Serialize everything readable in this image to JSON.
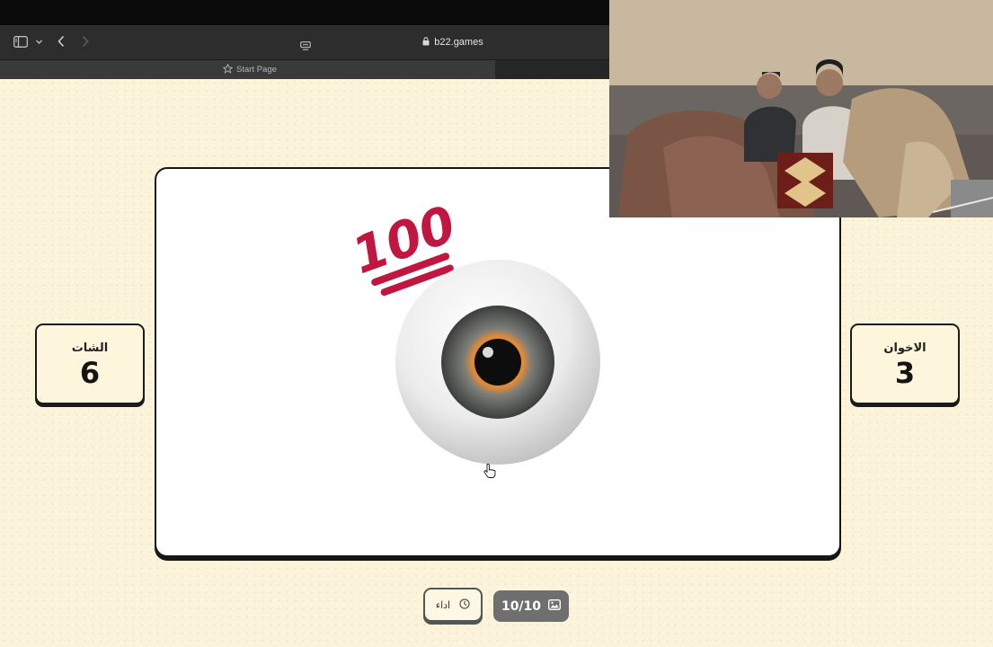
{
  "browser": {
    "address": "b22.games",
    "favorites_item": "Start Page"
  },
  "game": {
    "left_team": {
      "name": "الشات",
      "score": "6"
    },
    "right_team": {
      "name": "الاخوان",
      "score": "3"
    },
    "question_emojis": [
      "100-emoji",
      "eye-emoji"
    ],
    "performance_button": "اداء",
    "counter": "10/10"
  },
  "colors": {
    "page_bg": "#fcf4da",
    "hundred_red": "#c0163f",
    "counter_bg": "#6f6f6f"
  }
}
